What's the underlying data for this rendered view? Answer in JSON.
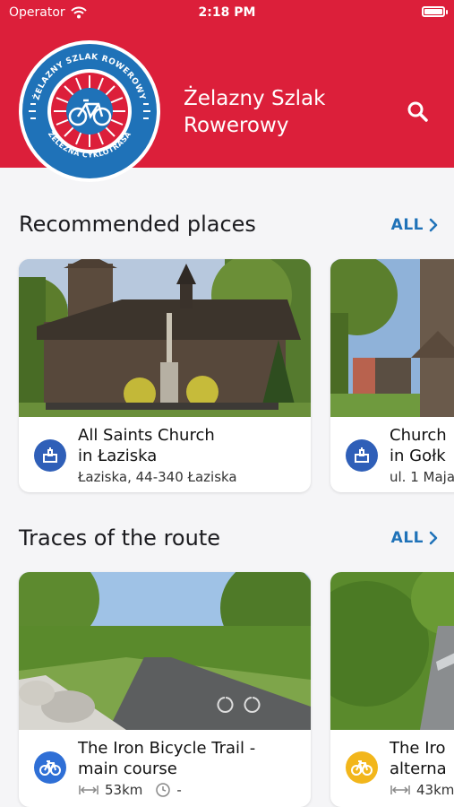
{
  "status_bar": {
    "carrier": "Operator",
    "time": "2:18 PM"
  },
  "header": {
    "title": "Żelazny Szlak Rowerowy",
    "title_line1": "Żelazny Szlak",
    "title_line2": "Rowerowy",
    "logo_text_top": "ŻELAZNY SZLAK ROWEROWY",
    "logo_text_bottom": "ŽELEZNÁ CYKLOTRASA",
    "search_icon": "search-icon"
  },
  "colors": {
    "brand_red": "#dc1f3a",
    "logo_blue": "#1f72b8",
    "accent_blue": "#1f72b8",
    "route_yellow": "#f2b61b"
  },
  "recommended": {
    "title": "Recommended places",
    "all_label": "ALL",
    "items": [
      {
        "title_line1": "All Saints Church",
        "title_line2": "in Łaziska",
        "address": "Łaziska, 44-340 Łaziska",
        "icon": "church-icon"
      },
      {
        "title_line1": "Church",
        "title_line2": "in Gołk",
        "address": "ul. 1 Maja",
        "icon": "church-icon"
      }
    ]
  },
  "traces": {
    "title": "Traces of the route",
    "all_label": "ALL",
    "items": [
      {
        "title_line1": "The Iron Bicycle Trail -",
        "title_line2": "main course",
        "distance": "53km",
        "duration": "-",
        "icon": "bicycle-icon"
      },
      {
        "title_line1": "The Iro",
        "title_line2": "alterna",
        "distance": "43km",
        "icon": "bicycle-icon"
      }
    ]
  }
}
